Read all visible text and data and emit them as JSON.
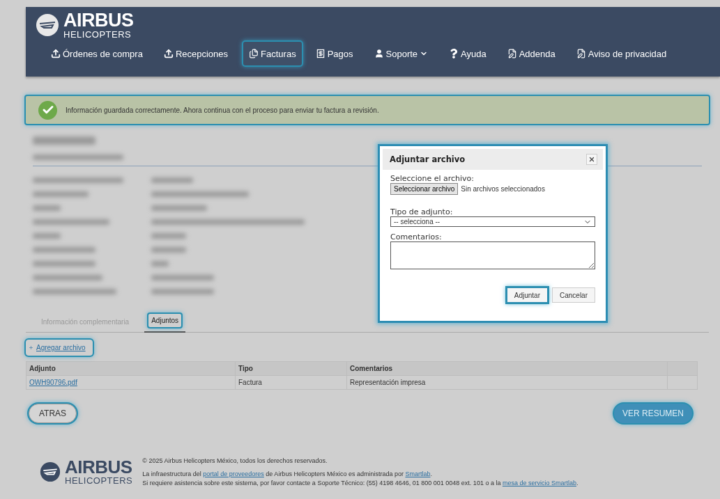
{
  "header": {
    "logo": {
      "name": "AIRBUS",
      "sub": "HELICOPTERS"
    },
    "nav": [
      {
        "label": "Órdenes de compra",
        "kind": "upload",
        "selected": false,
        "dropdown": false
      },
      {
        "label": "Recepciones",
        "kind": "upload",
        "selected": false,
        "dropdown": false
      },
      {
        "label": "Facturas",
        "kind": "files",
        "selected": true,
        "dropdown": false
      },
      {
        "label": "Pagos",
        "kind": "receipt",
        "selected": false,
        "dropdown": false
      },
      {
        "label": "Soporte",
        "kind": "user",
        "selected": false,
        "dropdown": true
      },
      {
        "label": "Ayuda",
        "kind": "question",
        "selected": false,
        "dropdown": false
      },
      {
        "label": "Addenda",
        "kind": "document",
        "selected": false,
        "dropdown": false
      },
      {
        "label": "Aviso de privacidad",
        "kind": "document",
        "selected": false,
        "dropdown": false
      }
    ]
  },
  "alert": {
    "message": "Información guardada correctamente. Ahora continua con el proceso para enviar tu factura a revisión."
  },
  "tabs": [
    {
      "label": "Información complementaria",
      "selected": false
    },
    {
      "label": "Adjuntos",
      "selected": true
    }
  ],
  "add_link": "Agregar archivo",
  "table": {
    "columns": [
      "Adjunto",
      "Tipo",
      "Comentarios"
    ],
    "rows": [
      {
        "file": "OWH90796.pdf",
        "type": "Factura",
        "comment": "Representación impresa"
      }
    ]
  },
  "buttons": {
    "back": "ATRAS",
    "summary": "VER RESUMEN"
  },
  "modal": {
    "title": "Adjuntar archivo",
    "file_label": "Seleccione el archivo:",
    "file_button": "Seleccionar archivo",
    "file_status": "Sin archivos seleccionados",
    "type_label": "Tipo de adjunto:",
    "type_value": "-- selecciona --",
    "comments_label": "Comentarios:",
    "primary": "Adjuntar",
    "secondary": "Cancelar"
  },
  "footer": {
    "logo": {
      "name": "AIRBUS",
      "sub": "HELICOPTERS"
    },
    "copyright": "© 2025 Airbus Helicopters México, todos los derechos reservados.",
    "lines": [
      [
        {
          "kind": "text",
          "text": "La infraestructura del "
        },
        {
          "kind": "link",
          "text": "portal de proveedores"
        },
        {
          "kind": "text",
          "text": " de Airbus Helicopters México es administrada por "
        },
        {
          "kind": "link",
          "text": "Smartlab"
        },
        {
          "kind": "text",
          "text": "."
        }
      ],
      [
        {
          "kind": "text",
          "text": "Si requiere asistencia sobre este sistema, por favor contacte a Soporte Técnico: (55) 4198 4646, 01 800 001 0048 ext. 101 o a la "
        },
        {
          "kind": "link",
          "text": "mesa de servicio Smartlab"
        },
        {
          "kind": "text",
          "text": "."
        }
      ]
    ]
  }
}
